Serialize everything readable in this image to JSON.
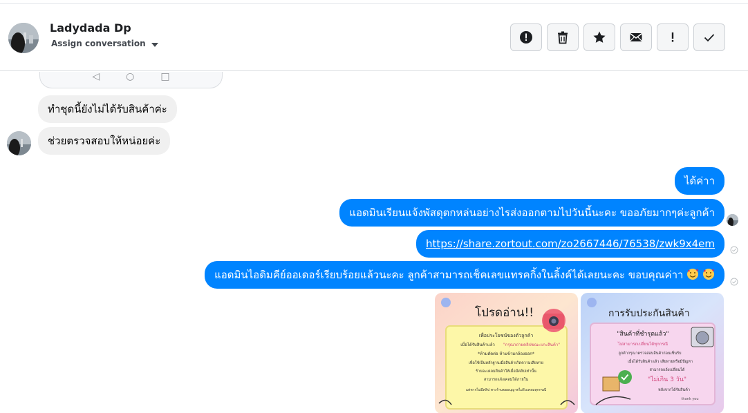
{
  "contact": {
    "name": "Ladydada Dp",
    "assign_label": "Assign conversation"
  },
  "toolbar": {
    "buttons": [
      {
        "name": "spam-button",
        "icon": "alert-circle-icon"
      },
      {
        "name": "delete-button",
        "icon": "trash-icon"
      },
      {
        "name": "star-button",
        "icon": "star-icon"
      },
      {
        "name": "mark-unread-button",
        "icon": "envelope-icon"
      },
      {
        "name": "follow-up-button",
        "icon": "exclamation-icon"
      },
      {
        "name": "mark-done-button",
        "icon": "check-icon"
      }
    ]
  },
  "messages": {
    "incoming": [
      "ทำชุดนี้ยังไม่ได้รับสินค้าค่ะ",
      "ช่วยตรวจสอบให้หน่อยค่ะ"
    ],
    "outgoing": [
      "ได้ค่าา",
      "แอดมินเรียนแจ้งพัสดุตกหล่นอย่างไรส่งออกตามไปวันนี้นะคะ ขออภัยมากๆค่ะลูกค้า",
      "https://share.zortout.com/zo2667446/76538/zwk9x4em",
      "แอดมินไอดิมคีย์ออเดอร์เรียบร้อยแล้วนะคะ ลูกค้าสามารถเช็คเลขแทรคกิ้งในลิ้งค์ได้เลยนะคะ ขอบคุณค่าา"
    ]
  },
  "images": {
    "card1": {
      "title": "โปรดอ่าน!!",
      "line1": "เพื่อประโยชน์ของตัวลูกค้า",
      "line2": "เมื่อได้รับสินค้าแล้ว",
      "line3": "\"กรุณาถ่ายคลิปขณะแกะสินค้า\"",
      "line4": "*ห้ามตัดต่อ ห้ามข้ามกล้องออก*",
      "line5": "เพื่อใช้เป็นหลักฐานเมื่อสินค้าเกิดความเสียหาย",
      "line6": "ร้านจะเคลมสินค้าให้เมื่อมีคลิปเท่านั้น",
      "line7": "สามารถแจ้งเคลมได้ภายใน",
      "line8": "แต่หากไม่มีคลิป ทางร้านขออนุญาตไม่รับเคลมทุกกรณี"
    },
    "card2": {
      "title": "การรับประกันสินค้า",
      "line1": "\"สินค้าที่ชำรุดแล้ว\"",
      "line2": "ไม่สามารถเปลี่ยนได้ทุกกรณี",
      "line3": "ลูกค้ากรุณาตรวจสอบสินค้าก่อนเซ็นรับ",
      "line4": "เมื่อได้รับสินค้าแล้ว เสียหายหรือมีปัญหา",
      "line5": "สามารถแจ้งเปลี่ยนได้",
      "line6": "\"ไม่เกิน 3 วัน\"",
      "line7": "หลังจากได้รับสินค้า",
      "line8": "thank you"
    }
  },
  "colors": {
    "accent": "#0084ff",
    "incoming_bubble": "#f0f0f0",
    "border": "#ccd0d5"
  }
}
